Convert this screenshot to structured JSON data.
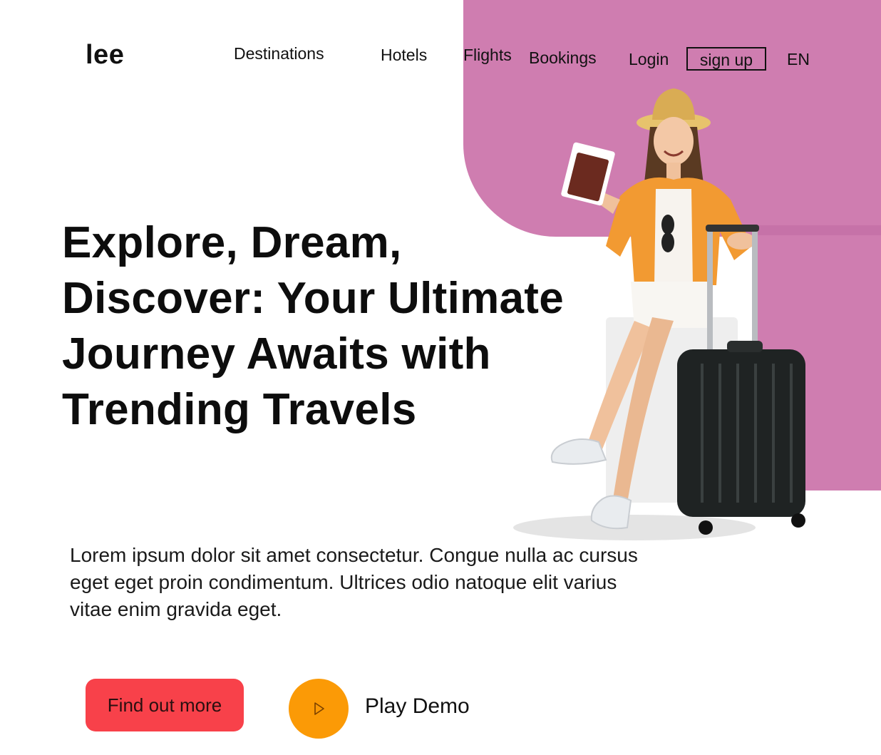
{
  "brand": {
    "logo": "lee"
  },
  "nav": {
    "links": [
      "Destinations",
      "Hotels",
      "Flights",
      "Bookings"
    ],
    "login": "Login",
    "signup": "sign up",
    "language": "EN"
  },
  "hero": {
    "title": "Explore, Dream, Discover: Your Ultimate Journey Awaits with Trending Travels",
    "description": "Lorem ipsum dolor sit amet consectetur. Congue nulla ac cursus eget eget proin condimentum. Ultrices odio natoque elit varius vitae enim gravida eget.",
    "primary_button": "Find out more",
    "demo_label": "Play Demo"
  },
  "icons": {
    "play": "play-icon"
  },
  "colors": {
    "accent_pink": "#cf7db0",
    "button_red": "#f8414a",
    "play_orange": "#fb9a06",
    "text_dark": "#111111"
  }
}
